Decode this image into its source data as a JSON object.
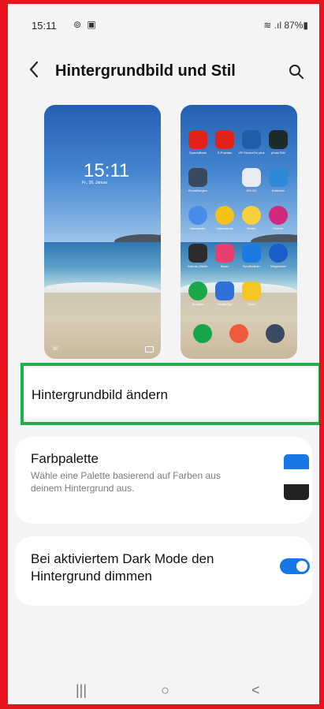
{
  "status_bar": {
    "time": "15:11",
    "left_icons": "⊚ ▣",
    "right": "⁆ .ıl 87%▮",
    "battery": "87%"
  },
  "app_bar": {
    "title": "Hintergrundbild und Stil"
  },
  "previews": {
    "lock": {
      "clock": "15:11",
      "date": "Fr., 26. Januar"
    },
    "home": {
      "apps": [
        "SpardaBank",
        "S-Pushtan",
        "VR SecureGo plus",
        "photoTAN",
        "Einstellungen",
        "WN OZ",
        "Kalender",
        "Übersetzer",
        "nebenan.de",
        "Wetter",
        "Galerie",
        "Kalorie-Zähler",
        "Music",
        "Schrittzähler",
        "Wegweiser",
        "Eingabe",
        "WhatsApp",
        "Tipps"
      ]
    },
    "colors": {
      "accent": "#1877e6"
    }
  },
  "items": {
    "change_wallpaper": "Hintergrundbild ändern",
    "palette_title": "Farbpalette",
    "palette_desc": "Wähle eine Palette basierend auf Farben aus deinem Hintergrund aus.",
    "dark_mode_dim": "Bei aktiviertem Dark Mode den Hintergrund dimmen",
    "dark_mode_dim_enabled": true
  },
  "nav": {
    "recents": "|||",
    "home": "○",
    "back": "<"
  },
  "annotation_colors": {
    "frame": "#e8141c",
    "highlight": "#1ab04b"
  }
}
